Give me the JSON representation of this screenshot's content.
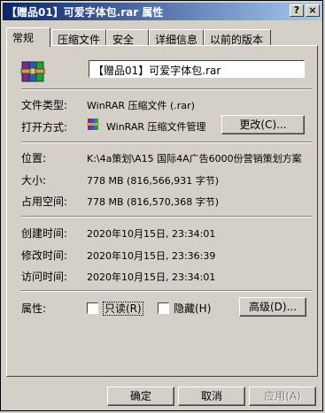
{
  "window": {
    "title": "【赠品01】可爱字体包.rar 属性",
    "help": "?",
    "close": "×"
  },
  "tabs": [
    "常规",
    "压缩文件",
    "安全",
    "详细信息",
    "以前的版本"
  ],
  "general": {
    "file_name": "【赠品01】可爱字体包.rar",
    "file_type_label": "文件类型:",
    "file_type_value": "WinRAR 压缩文件 (.rar)",
    "open_with_label": "打开方式:",
    "open_with_value": "WinRAR 压缩文件管理",
    "change_button": "更改(C)...",
    "location_label": "位置:",
    "location_value": "K:\\4a策划\\A15 国际4A广告6000份营销策划方案",
    "size_label": "大小:",
    "size_value": "778 MB (816,566,931 字节)",
    "disk_size_label": "占用空间:",
    "disk_size_value": "778 MB (816,570,368 字节)",
    "created_label": "创建时间:",
    "created_value": "2020年10月15日, 23:34:01",
    "modified_label": "修改时间:",
    "modified_value": "2020年10月15日, 23:36:39",
    "accessed_label": "访问时间:",
    "accessed_value": "2020年10月15日, 23:34:01",
    "attributes_label": "属性:",
    "readonly_label": "只读(R)",
    "hidden_label": "隐藏(H)",
    "advanced_button": "高级(D)..."
  },
  "footer": {
    "ok": "确定",
    "cancel": "取消",
    "apply": "应用(A)"
  }
}
